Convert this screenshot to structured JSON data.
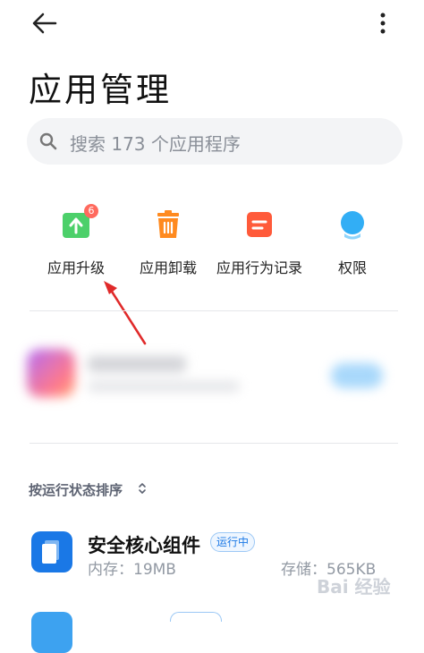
{
  "header": {
    "title": "应用管理"
  },
  "search": {
    "placeholder": "搜索 173 个应用程序"
  },
  "quick_actions": [
    {
      "label": "应用升级",
      "icon": "upload-arrow-icon",
      "badge": "6"
    },
    {
      "label": "应用卸载",
      "icon": "trash-icon"
    },
    {
      "label": "应用行为记录",
      "icon": "record-icon"
    },
    {
      "label": "权限",
      "icon": "shield-icon"
    }
  ],
  "sort": {
    "label": "按运行状态排序"
  },
  "apps": [
    {
      "name": "安全核心组件",
      "status": "运行中",
      "memory": "内存：19MB",
      "storage": "存储：565KB"
    },
    {
      "name": ""
    }
  ],
  "watermark": "Bai 经验",
  "colors": {
    "accent": "#1a78e6",
    "upgrade": "#4cd06a",
    "uninstall": "#ff8a1f",
    "history": "#ff5a3a",
    "permission": "#32aef5",
    "badge": "#ff6a5e",
    "annotation_arrow": "#e02a2a"
  }
}
